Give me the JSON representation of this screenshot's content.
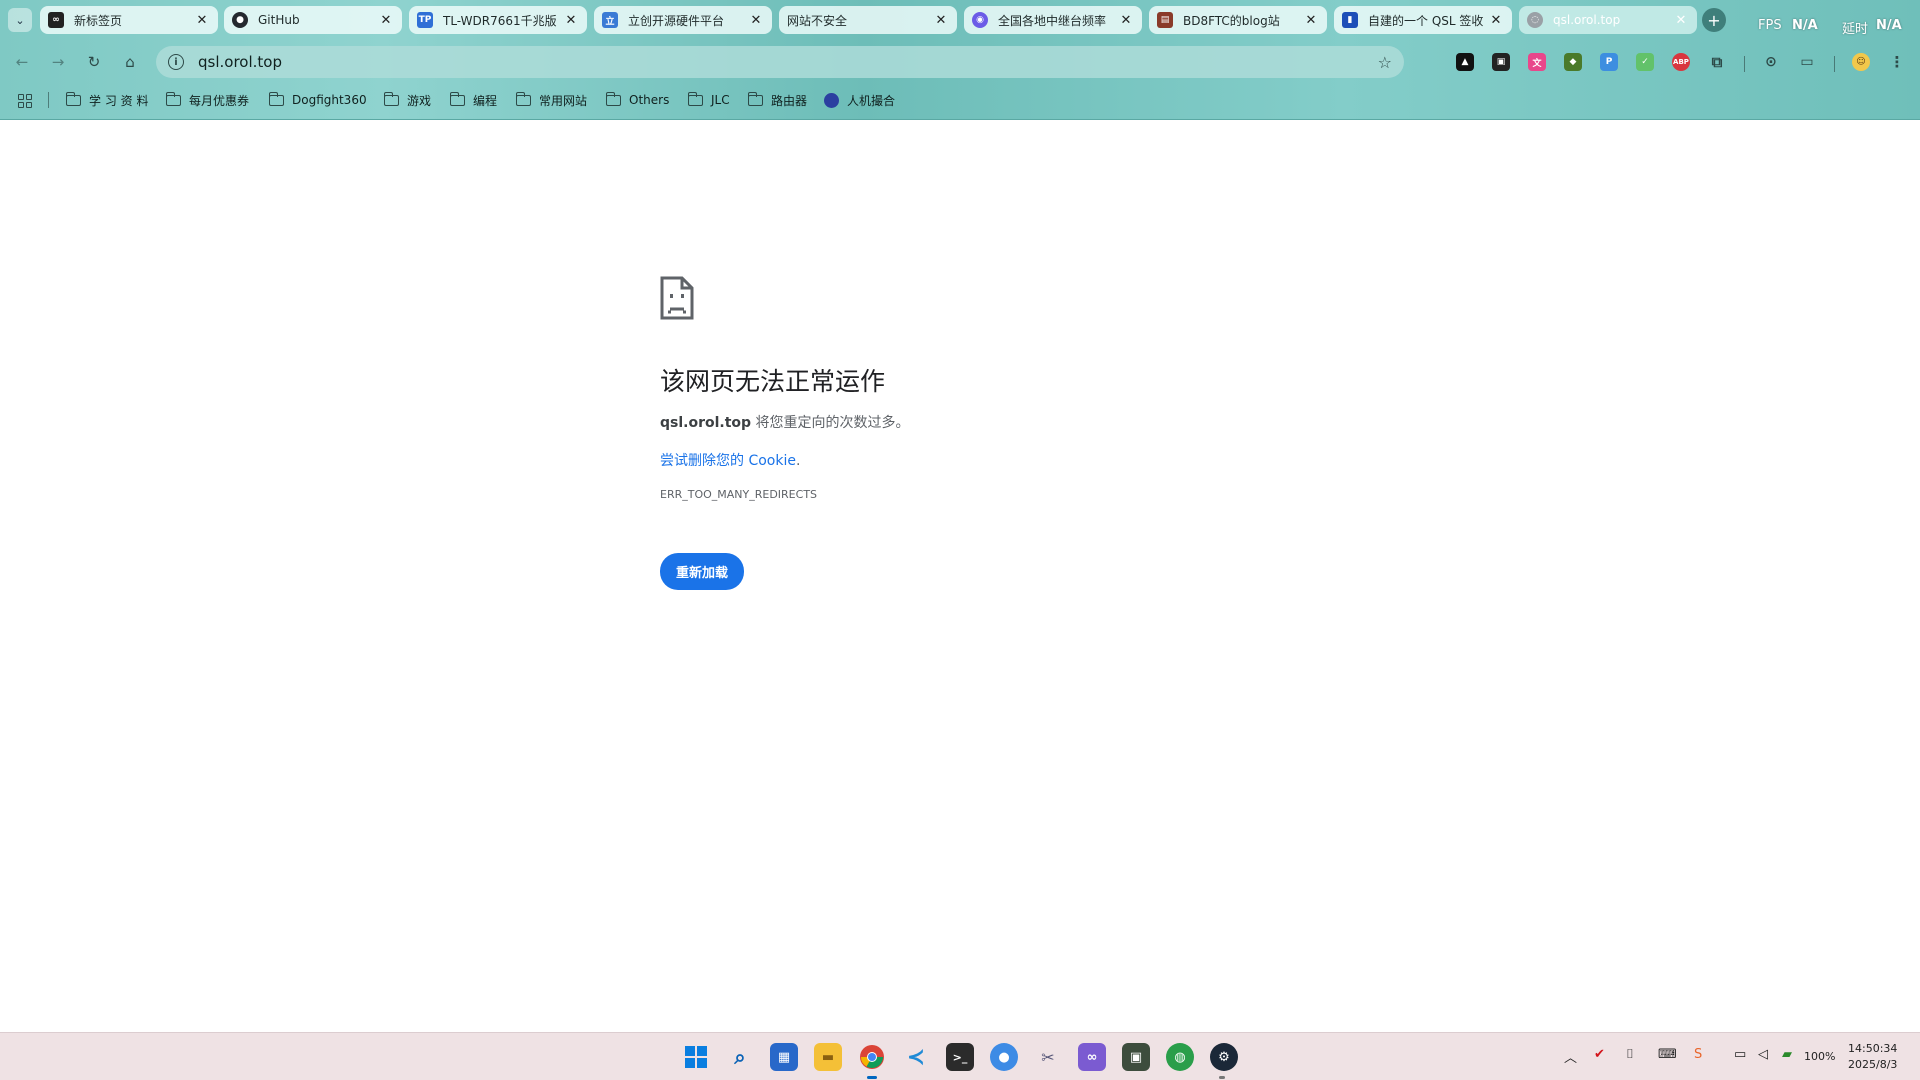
{
  "tabs": [
    {
      "title": "新标签页",
      "favicon": "chrome-newtab-icon",
      "color": "#222222"
    },
    {
      "title": "GitHub",
      "favicon": "github-icon",
      "color": "#24292f"
    },
    {
      "title": "TL-WDR7661千兆版",
      "favicon": "tplink-icon",
      "color": "#2f6fd6"
    },
    {
      "title": "立创开源硬件平台",
      "favicon": "lceda-icon",
      "color": "#3a7bd5"
    },
    {
      "title": "网站不安全",
      "favicon": "",
      "color": ""
    },
    {
      "title": "全国各地中继台频率",
      "favicon": "map-pin-icon",
      "color": "#6b5ce7"
    },
    {
      "title": "BD8FTC的blog站",
      "favicon": "blog-icon",
      "color": "#8a3b2a"
    },
    {
      "title": "自建的一个 QSL 签收",
      "favicon": "qsl-icon",
      "color": "#1d4fb8"
    },
    {
      "title": "qsl.orol.top",
      "favicon": "globe-icon",
      "color": "#9aa0a6",
      "active": true
    }
  ],
  "overlay": {
    "fps_label": "FPS",
    "fps_value": "N/A",
    "latency_label": "延时",
    "latency_value": "N/A"
  },
  "toolbar": {
    "url": "qsl.orol.top"
  },
  "bookmarks": {
    "items": [
      "学 习 资 料",
      "每月优惠券",
      "Dogfight360",
      "游戏",
      "编程",
      "常用网站",
      "Others",
      "JLC",
      "路由器",
      "人机撮合"
    ]
  },
  "error": {
    "title": "该网页无法正常运作",
    "host": "qsl.orol.top",
    "desc_suffix": " 将您重定向的次数过多。",
    "link": "尝试删除您的 Cookie",
    "link_suffix": ".",
    "code": "ERR_TOO_MANY_REDIRECTS",
    "button": "重新加载"
  },
  "tray": {
    "battery": "100%",
    "time": "14:50:34",
    "date": "2025/8/3"
  },
  "colors": {
    "accent": "#1a73e8",
    "chrome": "#7fc9c4",
    "taskbar": "#efe2e4"
  }
}
